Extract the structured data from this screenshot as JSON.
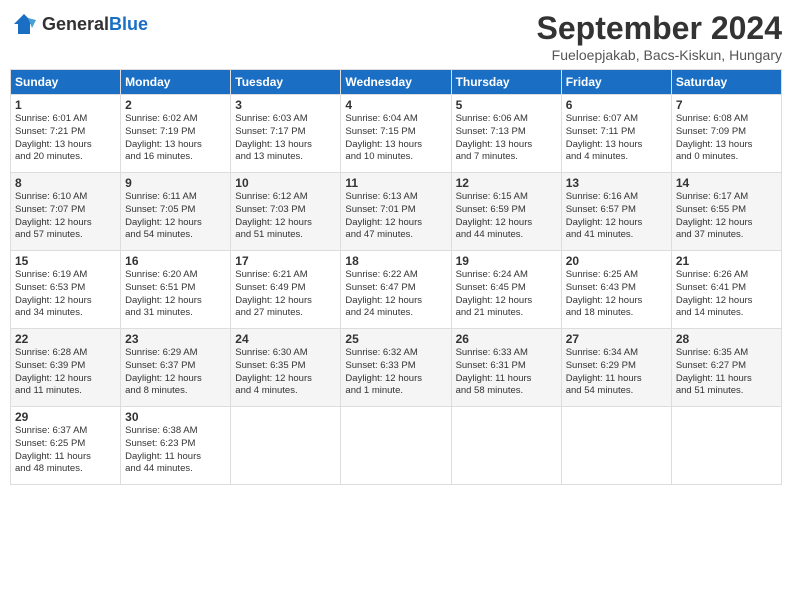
{
  "header": {
    "logo_general": "General",
    "logo_blue": "Blue",
    "title": "September 2024",
    "subtitle": "Fueloepjakab, Bacs-Kiskun, Hungary"
  },
  "days_of_week": [
    "Sunday",
    "Monday",
    "Tuesday",
    "Wednesday",
    "Thursday",
    "Friday",
    "Saturday"
  ],
  "weeks": [
    [
      {
        "day": 1,
        "lines": [
          "Sunrise: 6:01 AM",
          "Sunset: 7:21 PM",
          "Daylight: 13 hours",
          "and 20 minutes."
        ]
      },
      {
        "day": 2,
        "lines": [
          "Sunrise: 6:02 AM",
          "Sunset: 7:19 PM",
          "Daylight: 13 hours",
          "and 16 minutes."
        ]
      },
      {
        "day": 3,
        "lines": [
          "Sunrise: 6:03 AM",
          "Sunset: 7:17 PM",
          "Daylight: 13 hours",
          "and 13 minutes."
        ]
      },
      {
        "day": 4,
        "lines": [
          "Sunrise: 6:04 AM",
          "Sunset: 7:15 PM",
          "Daylight: 13 hours",
          "and 10 minutes."
        ]
      },
      {
        "day": 5,
        "lines": [
          "Sunrise: 6:06 AM",
          "Sunset: 7:13 PM",
          "Daylight: 13 hours",
          "and 7 minutes."
        ]
      },
      {
        "day": 6,
        "lines": [
          "Sunrise: 6:07 AM",
          "Sunset: 7:11 PM",
          "Daylight: 13 hours",
          "and 4 minutes."
        ]
      },
      {
        "day": 7,
        "lines": [
          "Sunrise: 6:08 AM",
          "Sunset: 7:09 PM",
          "Daylight: 13 hours",
          "and 0 minutes."
        ]
      }
    ],
    [
      {
        "day": 8,
        "lines": [
          "Sunrise: 6:10 AM",
          "Sunset: 7:07 PM",
          "Daylight: 12 hours",
          "and 57 minutes."
        ]
      },
      {
        "day": 9,
        "lines": [
          "Sunrise: 6:11 AM",
          "Sunset: 7:05 PM",
          "Daylight: 12 hours",
          "and 54 minutes."
        ]
      },
      {
        "day": 10,
        "lines": [
          "Sunrise: 6:12 AM",
          "Sunset: 7:03 PM",
          "Daylight: 12 hours",
          "and 51 minutes."
        ]
      },
      {
        "day": 11,
        "lines": [
          "Sunrise: 6:13 AM",
          "Sunset: 7:01 PM",
          "Daylight: 12 hours",
          "and 47 minutes."
        ]
      },
      {
        "day": 12,
        "lines": [
          "Sunrise: 6:15 AM",
          "Sunset: 6:59 PM",
          "Daylight: 12 hours",
          "and 44 minutes."
        ]
      },
      {
        "day": 13,
        "lines": [
          "Sunrise: 6:16 AM",
          "Sunset: 6:57 PM",
          "Daylight: 12 hours",
          "and 41 minutes."
        ]
      },
      {
        "day": 14,
        "lines": [
          "Sunrise: 6:17 AM",
          "Sunset: 6:55 PM",
          "Daylight: 12 hours",
          "and 37 minutes."
        ]
      }
    ],
    [
      {
        "day": 15,
        "lines": [
          "Sunrise: 6:19 AM",
          "Sunset: 6:53 PM",
          "Daylight: 12 hours",
          "and 34 minutes."
        ]
      },
      {
        "day": 16,
        "lines": [
          "Sunrise: 6:20 AM",
          "Sunset: 6:51 PM",
          "Daylight: 12 hours",
          "and 31 minutes."
        ]
      },
      {
        "day": 17,
        "lines": [
          "Sunrise: 6:21 AM",
          "Sunset: 6:49 PM",
          "Daylight: 12 hours",
          "and 27 minutes."
        ]
      },
      {
        "day": 18,
        "lines": [
          "Sunrise: 6:22 AM",
          "Sunset: 6:47 PM",
          "Daylight: 12 hours",
          "and 24 minutes."
        ]
      },
      {
        "day": 19,
        "lines": [
          "Sunrise: 6:24 AM",
          "Sunset: 6:45 PM",
          "Daylight: 12 hours",
          "and 21 minutes."
        ]
      },
      {
        "day": 20,
        "lines": [
          "Sunrise: 6:25 AM",
          "Sunset: 6:43 PM",
          "Daylight: 12 hours",
          "and 18 minutes."
        ]
      },
      {
        "day": 21,
        "lines": [
          "Sunrise: 6:26 AM",
          "Sunset: 6:41 PM",
          "Daylight: 12 hours",
          "and 14 minutes."
        ]
      }
    ],
    [
      {
        "day": 22,
        "lines": [
          "Sunrise: 6:28 AM",
          "Sunset: 6:39 PM",
          "Daylight: 12 hours",
          "and 11 minutes."
        ]
      },
      {
        "day": 23,
        "lines": [
          "Sunrise: 6:29 AM",
          "Sunset: 6:37 PM",
          "Daylight: 12 hours",
          "and 8 minutes."
        ]
      },
      {
        "day": 24,
        "lines": [
          "Sunrise: 6:30 AM",
          "Sunset: 6:35 PM",
          "Daylight: 12 hours",
          "and 4 minutes."
        ]
      },
      {
        "day": 25,
        "lines": [
          "Sunrise: 6:32 AM",
          "Sunset: 6:33 PM",
          "Daylight: 12 hours",
          "and 1 minute."
        ]
      },
      {
        "day": 26,
        "lines": [
          "Sunrise: 6:33 AM",
          "Sunset: 6:31 PM",
          "Daylight: 11 hours",
          "and 58 minutes."
        ]
      },
      {
        "day": 27,
        "lines": [
          "Sunrise: 6:34 AM",
          "Sunset: 6:29 PM",
          "Daylight: 11 hours",
          "and 54 minutes."
        ]
      },
      {
        "day": 28,
        "lines": [
          "Sunrise: 6:35 AM",
          "Sunset: 6:27 PM",
          "Daylight: 11 hours",
          "and 51 minutes."
        ]
      }
    ],
    [
      {
        "day": 29,
        "lines": [
          "Sunrise: 6:37 AM",
          "Sunset: 6:25 PM",
          "Daylight: 11 hours",
          "and 48 minutes."
        ]
      },
      {
        "day": 30,
        "lines": [
          "Sunrise: 6:38 AM",
          "Sunset: 6:23 PM",
          "Daylight: 11 hours",
          "and 44 minutes."
        ]
      },
      null,
      null,
      null,
      null,
      null
    ]
  ]
}
